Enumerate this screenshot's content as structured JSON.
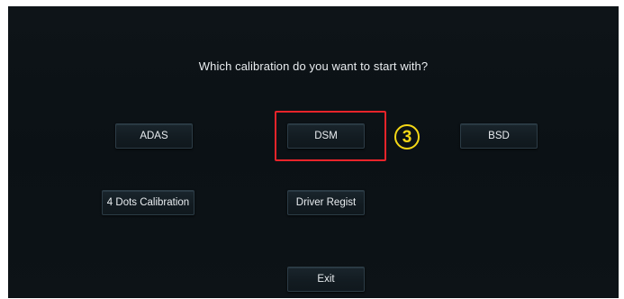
{
  "prompt": "Which calibration do you want to start with?",
  "buttons": {
    "adas": "ADAS",
    "dsm": "DSM",
    "bsd": "BSD",
    "four_dots": "4 Dots Calibration",
    "driver_regist": "Driver Regist",
    "exit": "Exit"
  },
  "annotation": {
    "step": "3",
    "highlight_color": "#e8242a",
    "badge_color": "#f5d816"
  }
}
